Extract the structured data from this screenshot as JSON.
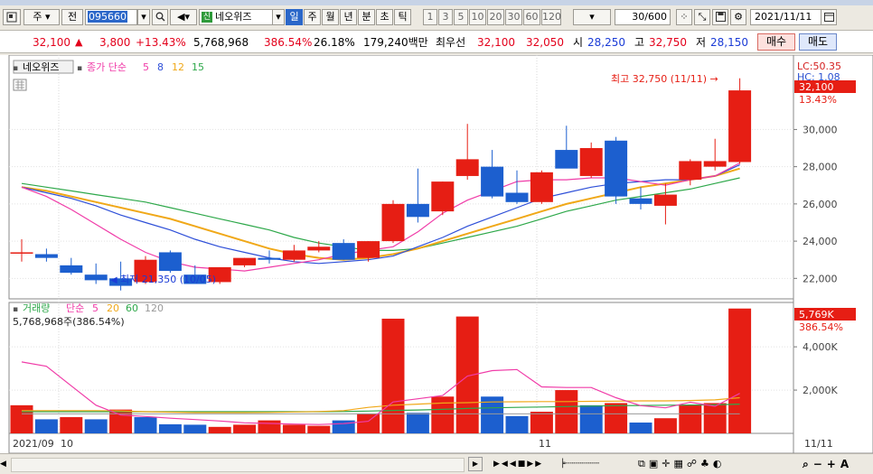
{
  "toolbar": {
    "type_label": "주",
    "prefix_label": "전",
    "code_value": "095660",
    "name_badge": "신",
    "name_value": "네오위즈",
    "periods": [
      "일",
      "주",
      "월",
      "년",
      "분",
      "초",
      "틱"
    ],
    "selected_period": "일",
    "intervals": [
      "1",
      "3",
      "5",
      "10",
      "20",
      "30",
      "60",
      "120"
    ],
    "count_value": "30/600",
    "date_value": "2021/11/11"
  },
  "info": {
    "price": "32,100",
    "change_arrow": "▲",
    "change": "3,800",
    "change_pct": "+13.43%",
    "volume": "5,768,968",
    "volume_ratio": "386.54%",
    "turnover": "26.18%",
    "amount": "179,240백만",
    "best_label": "최우선",
    "best_ask": "32,100",
    "best_bid": "32,050",
    "open_label": "시",
    "open": "28,250",
    "high_label": "고",
    "high": "32,750",
    "low_label": "저",
    "low": "28,150",
    "buy_label": "매수",
    "sell_label": "매도"
  },
  "legend": {
    "stock_name": "네오위즈",
    "ma_title": "종가 단순",
    "ma_periods": [
      "5",
      "8",
      "12",
      "15"
    ],
    "vol_title": "거래량",
    "vol_ma_title": "단순",
    "vol_ma_periods": [
      "5",
      "20",
      "60",
      "120"
    ],
    "vol_readout": "5,768,968주(386.54%)"
  },
  "annotations": {
    "high_note": "최고 32,750 (11/11) →",
    "low_note": "최저 21,350 (10/05)",
    "lc": "LC:50.35",
    "hc": "HC: 1.08",
    "price_tag": "32,100",
    "pct_tag": "13.43%",
    "vol_tag": "5,769K",
    "vol_pct_tag": "386.54%"
  },
  "x_labels": {
    "start": "2021/09",
    "oct": "10",
    "nov": "11",
    "end": "11/11"
  },
  "colors": {
    "up": "#e61e14",
    "down": "#1c5fcf",
    "ma5": "#f03ca8",
    "ma8": "#2e4fd8",
    "ma12": "#f0a818",
    "ma15": "#2ea84a",
    "vma120": "#999999"
  },
  "chart_data": [
    {
      "type": "candlestick",
      "y_ticks": [
        "22,000",
        "24,000",
        "26,000",
        "28,000",
        "30,000"
      ],
      "ylim": [
        20900,
        33900
      ],
      "candles": [
        {
          "o": 23400,
          "h": 24100,
          "l": 22900,
          "c": 23400
        },
        {
          "o": 23300,
          "h": 23600,
          "l": 22900,
          "c": 23100
        },
        {
          "o": 22700,
          "h": 23100,
          "l": 22200,
          "c": 22300
        },
        {
          "o": 22200,
          "h": 22800,
          "l": 21700,
          "c": 21900
        },
        {
          "o": 22000,
          "h": 22900,
          "l": 21350,
          "c": 21600
        },
        {
          "o": 21800,
          "h": 23200,
          "l": 21700,
          "c": 23000
        },
        {
          "o": 23400,
          "h": 23500,
          "l": 22300,
          "c": 22400
        },
        {
          "o": 22200,
          "h": 22700,
          "l": 21900,
          "c": 21700
        },
        {
          "o": 21800,
          "h": 22600,
          "l": 21700,
          "c": 22600
        },
        {
          "o": 22700,
          "h": 23100,
          "l": 22600,
          "c": 23100
        },
        {
          "o": 23100,
          "h": 23500,
          "l": 22800,
          "c": 23000
        },
        {
          "o": 23000,
          "h": 23800,
          "l": 22900,
          "c": 23500
        },
        {
          "o": 23500,
          "h": 24000,
          "l": 23400,
          "c": 23700
        },
        {
          "o": 23900,
          "h": 24100,
          "l": 23000,
          "c": 23000
        },
        {
          "o": 23100,
          "h": 24000,
          "l": 22900,
          "c": 24000
        },
        {
          "o": 24000,
          "h": 26200,
          "l": 23900,
          "c": 26000
        },
        {
          "o": 26000,
          "h": 27900,
          "l": 25000,
          "c": 25300
        },
        {
          "o": 25600,
          "h": 27200,
          "l": 25400,
          "c": 27200
        },
        {
          "o": 27500,
          "h": 30300,
          "l": 27300,
          "c": 28400
        },
        {
          "o": 28000,
          "h": 28900,
          "l": 26300,
          "c": 26400
        },
        {
          "o": 26600,
          "h": 27800,
          "l": 26000,
          "c": 26100
        },
        {
          "o": 26100,
          "h": 27800,
          "l": 26000,
          "c": 27700
        },
        {
          "o": 28900,
          "h": 30200,
          "l": 28600,
          "c": 27900
        },
        {
          "o": 27500,
          "h": 29300,
          "l": 27400,
          "c": 29000
        },
        {
          "o": 29400,
          "h": 29600,
          "l": 26000,
          "c": 26400
        },
        {
          "o": 26300,
          "h": 26900,
          "l": 25700,
          "c": 26000
        },
        {
          "o": 25900,
          "h": 27100,
          "l": 24900,
          "c": 26500
        },
        {
          "o": 27300,
          "h": 28400,
          "l": 27000,
          "c": 28300
        },
        {
          "o": 28000,
          "h": 29500,
          "l": 27800,
          "c": 28300
        },
        {
          "o": 28250,
          "h": 32750,
          "l": 28150,
          "c": 32100
        }
      ],
      "ma5": [
        26900,
        26400,
        25700,
        24900,
        24100,
        23400,
        22900,
        22600,
        22500,
        22400,
        22600,
        22800,
        23000,
        23300,
        23500,
        23700,
        24500,
        25500,
        26200,
        26700,
        27200,
        27300,
        27300,
        27400,
        27400,
        27200,
        27000,
        27300,
        27500,
        28200
      ],
      "ma8": [
        26900,
        26600,
        26300,
        25900,
        25400,
        25000,
        24600,
        24100,
        23700,
        23400,
        23100,
        22900,
        22800,
        22900,
        23000,
        23200,
        23700,
        24200,
        24800,
        25300,
        25800,
        26300,
        26600,
        26900,
        27100,
        27200,
        27300,
        27300,
        27500,
        28100
      ],
      "ma12": [
        26900,
        26700,
        26400,
        26100,
        25800,
        25500,
        25200,
        24800,
        24400,
        24000,
        23600,
        23300,
        23100,
        23000,
        23100,
        23300,
        23600,
        24000,
        24400,
        24800,
        25200,
        25600,
        26000,
        26300,
        26600,
        26900,
        27100,
        27300,
        27500,
        27900
      ],
      "ma15": [
        27100,
        26900,
        26700,
        26500,
        26300,
        26100,
        25800,
        25500,
        25200,
        24900,
        24600,
        24200,
        23900,
        23700,
        23500,
        23500,
        23600,
        23900,
        24200,
        24500,
        24800,
        25200,
        25600,
        25900,
        26200,
        26400,
        26600,
        26800,
        27100,
        27400
      ]
    },
    {
      "type": "bar",
      "name": "거래량",
      "y_ticks": [
        "2,000K",
        "4,000K"
      ],
      "ylim": [
        0,
        6050
      ],
      "values": [
        1300,
        650,
        750,
        650,
        1100,
        750,
        420,
        400,
        300,
        400,
        600,
        400,
        350,
        600,
        900,
        5300,
        950,
        1700,
        5400,
        1700,
        800,
        1000,
        2000,
        1300,
        1400,
        500,
        700,
        1300,
        1400,
        5769
      ],
      "up": [
        true,
        false,
        true,
        false,
        true,
        false,
        false,
        false,
        true,
        true,
        true,
        true,
        true,
        false,
        true,
        true,
        false,
        true,
        true,
        false,
        false,
        true,
        true,
        false,
        true,
        false,
        true,
        true,
        true,
        true
      ],
      "ma5": [
        3300,
        3100,
        2200,
        1300,
        850,
        780,
        700,
        640,
        570,
        490,
        460,
        430,
        410,
        450,
        560,
        1450,
        1600,
        1750,
        2650,
        2900,
        2950,
        2150,
        2120,
        2120,
        1650,
        1280,
        1180,
        1440,
        1250,
        1850
      ],
      "ma20": [
        1050,
        1050,
        1050,
        1050,
        1040,
        1000,
        980,
        960,
        960,
        960,
        970,
        990,
        1010,
        1050,
        1200,
        1300,
        1350,
        1400,
        1420,
        1450,
        1460,
        1470,
        1470,
        1480,
        1490,
        1500,
        1500,
        1520,
        1550,
        1650
      ],
      "ma60": [
        1000,
        1000,
        1000,
        1000,
        1000,
        1000,
        1000,
        1000,
        1000,
        1000,
        1000,
        1000,
        1000,
        1010,
        1030,
        1060,
        1080,
        1110,
        1150,
        1180,
        1200,
        1220,
        1240,
        1260,
        1280,
        1290,
        1300,
        1310,
        1320,
        1350
      ],
      "ma120": [
        900,
        900,
        900,
        900,
        900,
        900,
        900,
        900,
        900,
        900,
        900,
        900,
        900,
        900,
        900,
        900,
        900,
        900,
        900,
        900,
        900,
        900,
        900,
        900,
        900,
        900,
        900,
        900,
        900,
        900
      ]
    }
  ]
}
